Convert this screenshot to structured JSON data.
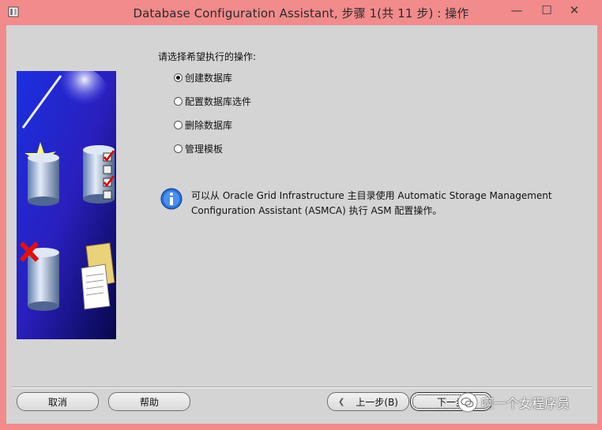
{
  "window": {
    "title": "Database Configuration Assistant, 步骤 1(共 11 步) : 操作",
    "controls": {
      "minimize": "—",
      "maximize": "☐",
      "close": "✕"
    }
  },
  "main": {
    "prompt": "请选择希望执行的操作:",
    "options": [
      {
        "label": "创建数据库",
        "selected": true
      },
      {
        "label": "配置数据库选件",
        "selected": false
      },
      {
        "label": "删除数据库",
        "selected": false
      },
      {
        "label": "管理模板",
        "selected": false
      }
    ],
    "info_text": "可以从 Oracle Grid Infrastructure 主目录使用 Automatic Storage Management Configuration Assistant (ASMCA) 执行 ASM 配置操作。"
  },
  "footer": {
    "cancel_label": "取消",
    "help_label": "帮助",
    "back_label": "上一步(B)",
    "next_label": "下一步"
  },
  "watermark": {
    "text": "啊一个女程序员"
  },
  "colors": {
    "titlebar": "#f28b8b",
    "client": "#d4d4d4",
    "art_blue": "#1a1ab0"
  }
}
